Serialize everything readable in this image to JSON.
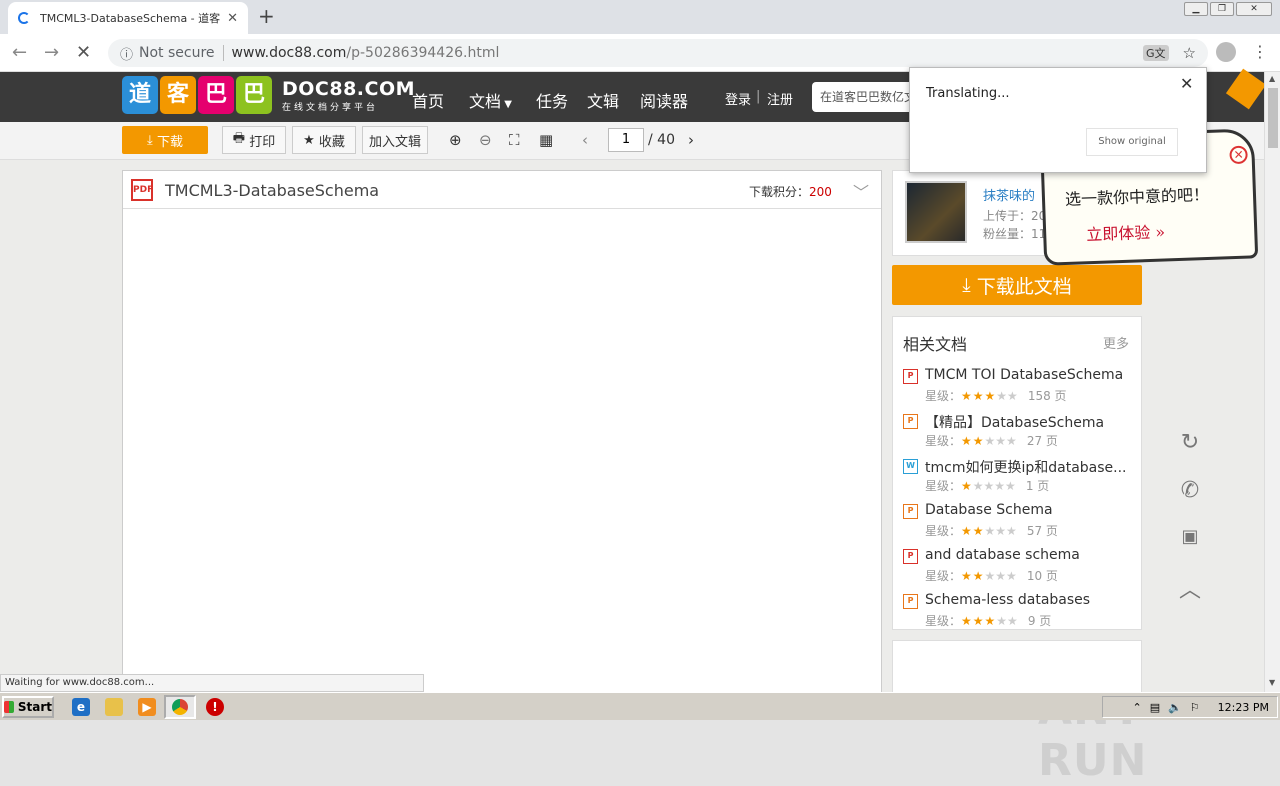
{
  "browser": {
    "tab_title": "TMCML3-DatabaseSchema - 道客巴巴",
    "tab_close": "✕",
    "new_tab": "+",
    "security_label": "Not secure",
    "url_host": "www.doc88.com",
    "url_path": "/p-50286394426.html"
  },
  "site": {
    "logo_chars": [
      "道",
      "客",
      "巴",
      "巴"
    ],
    "logo_domain": "DOC88.COM",
    "logo_tagline": "在线文档分享平台",
    "nav": [
      "首页",
      "文档",
      "任务",
      "文辑",
      "阅读器"
    ],
    "login": "登录",
    "divider": "|",
    "register": "注册",
    "search_placeholder": "在道客巴巴数亿文"
  },
  "toolbar": {
    "download": "下载",
    "print": "打印",
    "favorite": "收藏",
    "add_collection": "加入文辑",
    "page_current": "1",
    "page_total": "/ 40"
  },
  "document": {
    "title": "TMCML3-DatabaseSchema",
    "points_label": "下载积分：",
    "points_value": "200"
  },
  "uploader": {
    "name": "抹茶味的",
    "uploaded_label": "上传于：20",
    "fans_label": "粉丝量：11"
  },
  "big_download": "下载此文档",
  "related": {
    "title": "相关文档",
    "more": "更多",
    "rating_label": "星级：",
    "items": [
      {
        "title": "TMCM TOI DatabaseSchema",
        "stars": 3,
        "pages": "158 页",
        "type": "pdf"
      },
      {
        "title": "【精品】DatabaseSchema",
        "stars": 2,
        "pages": "27 页",
        "type": "ppt"
      },
      {
        "title": "tmcm如何更换ip和database...",
        "stars": 1,
        "pages": "1 页",
        "type": "doc"
      },
      {
        "title": "Database Schema",
        "stars": 2,
        "pages": "57 页",
        "type": "ppt"
      },
      {
        "title": "and database schema",
        "stars": 2,
        "pages": "10 页",
        "type": "pdf"
      },
      {
        "title": "Schema-less databases",
        "stars": 3,
        "pages": "9 页",
        "type": "ppt"
      }
    ]
  },
  "promo": {
    "line1": "选一款你中意的吧！",
    "line2": "立即体验 »"
  },
  "translate_popup": {
    "status": "Translating...",
    "show_original": "Show original"
  },
  "status_bar": "Waiting for www.doc88.com...",
  "watermark": "ANY RUN",
  "taskbar": {
    "start": "Start",
    "clock": "12:23 PM"
  },
  "colors": {
    "accent_orange": "#f39800",
    "site_header": "#3a3a3a",
    "pdf_red": "#d9312a"
  }
}
